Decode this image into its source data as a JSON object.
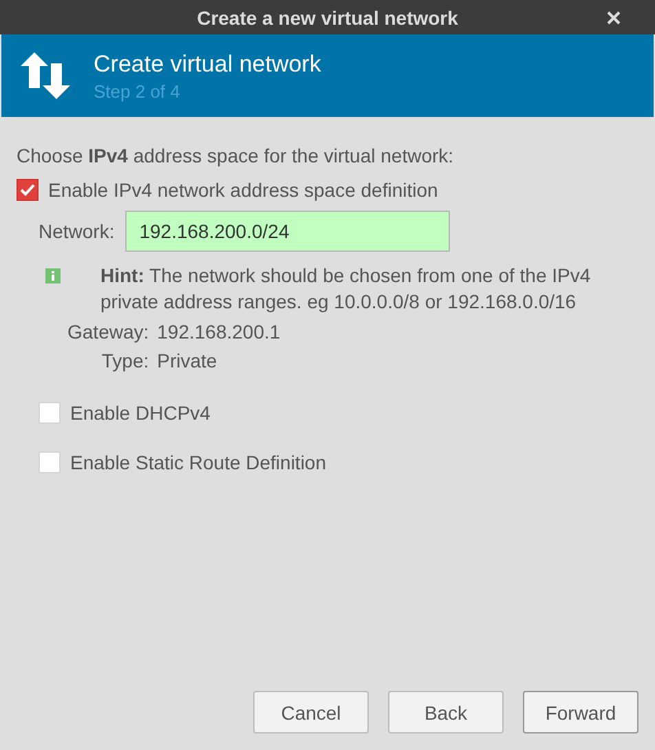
{
  "window": {
    "title": "Create a new virtual network"
  },
  "header": {
    "title": "Create virtual network",
    "step": "Step 2 of 4"
  },
  "prompt": "Choose **IPv4** address space for the virtual network:",
  "enable_ipv4": {
    "label": "Enable IPv4 network address space definition",
    "checked": true
  },
  "network": {
    "label": "Network:",
    "value": "192.168.200.0/24",
    "valid": true
  },
  "hint": "**Hint:** The network should be chosen from one of the IPv4 private address ranges. eg 10.0.0.0/8 or 192.168.0.0/16",
  "details": [
    {
      "label": "Gateway:",
      "value": "192.168.200.1"
    },
    {
      "label": "Type:",
      "value": "Private"
    }
  ],
  "options": [
    {
      "label": "Enable DHCPv4",
      "checked": false
    },
    {
      "label": "Enable Static Route Definition",
      "checked": false
    }
  ],
  "buttons": [
    "Cancel",
    "Back",
    "Forward"
  ]
}
